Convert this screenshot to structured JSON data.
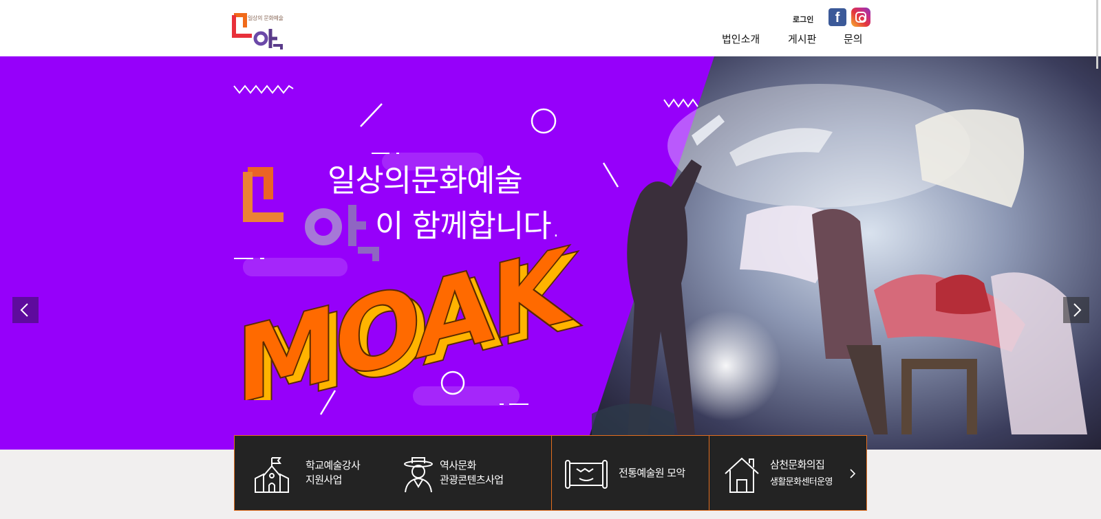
{
  "logo": {
    "name": "모악",
    "tagline": "일상의 문화예술"
  },
  "header": {
    "login_label": "로그인",
    "facebook_icon": "facebook-icon",
    "instagram_icon": "instagram-icon",
    "nav": [
      "법인소개",
      "게시판",
      "문의"
    ]
  },
  "hero": {
    "line1": "일상의문화예술",
    "line2": "이 함께합니다.",
    "logo_word": "모악",
    "big_word": "MOAK",
    "prev_icon": "chevron-left-icon",
    "next_icon": "chevron-right-icon"
  },
  "quick_menu": {
    "items": [
      {
        "icon": "school-icon",
        "line1": "학교예술강사",
        "line2": "지원사업"
      },
      {
        "icon": "person-gat-icon",
        "line1": "역사문화",
        "line2": "관광콘텐츠사업"
      },
      {
        "icon": "scroll-icon",
        "line1": "전통예술원 모악",
        "line2": ""
      },
      {
        "icon": "house-icon",
        "line1": "삼천문화의집",
        "line2": "생활문화센터운영"
      }
    ],
    "more_icon": "chevron-right-icon"
  },
  "colors": {
    "hero_purple": "#9600fa",
    "accent_orange": "#e46f1f",
    "quick_bg": "#232323",
    "moak_fill": "#ff6a00",
    "moak_side": "#ffb400"
  }
}
